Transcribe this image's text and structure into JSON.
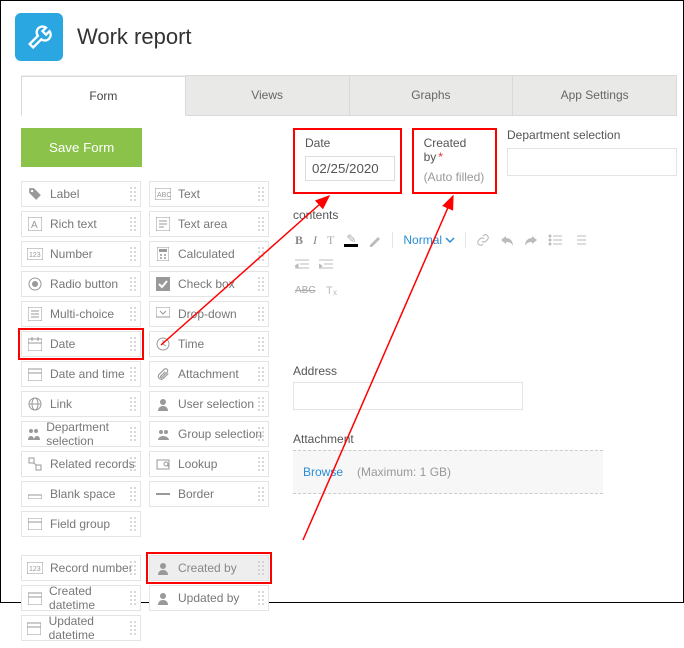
{
  "app": {
    "title": "Work report"
  },
  "tabs": [
    {
      "label": "Form",
      "active": true
    },
    {
      "label": "Views"
    },
    {
      "label": "Graphs"
    },
    {
      "label": "App Settings"
    }
  ],
  "buttons": {
    "save_form": "Save Form"
  },
  "palette": {
    "left": [
      {
        "name": "label",
        "label": "Label",
        "icon": "tag"
      },
      {
        "name": "rich-text",
        "label": "Rich text",
        "icon": "rich"
      },
      {
        "name": "number",
        "label": "Number",
        "icon": "num"
      },
      {
        "name": "radio-button",
        "label": "Radio button",
        "icon": "radio"
      },
      {
        "name": "multi-choice",
        "label": "Multi-choice",
        "icon": "multi"
      },
      {
        "name": "date",
        "label": "Date",
        "icon": "cal",
        "highlight": true
      },
      {
        "name": "date-and-time",
        "label": "Date and time",
        "icon": "cal"
      },
      {
        "name": "link",
        "label": "Link",
        "icon": "globe"
      },
      {
        "name": "department-selection",
        "label": "Department selection",
        "icon": "dept"
      },
      {
        "name": "related-records",
        "label": "Related records",
        "icon": "related"
      },
      {
        "name": "blank-space",
        "label": "Blank space",
        "icon": "blank"
      },
      {
        "name": "field-group",
        "label": "Field group",
        "icon": "group"
      }
    ],
    "right": [
      {
        "name": "text",
        "label": "Text",
        "icon": "abc"
      },
      {
        "name": "text-area",
        "label": "Text area",
        "icon": "textarea"
      },
      {
        "name": "calculated",
        "label": "Calculated",
        "icon": "calc"
      },
      {
        "name": "check-box",
        "label": "Check box",
        "icon": "check"
      },
      {
        "name": "drop-down",
        "label": "Drop-down",
        "icon": "drop"
      },
      {
        "name": "time",
        "label": "Time",
        "icon": "clock"
      },
      {
        "name": "attachment",
        "label": "Attachment",
        "icon": "clip"
      },
      {
        "name": "user-selection",
        "label": "User selection",
        "icon": "user"
      },
      {
        "name": "group-selection",
        "label": "Group selection",
        "icon": "group2"
      },
      {
        "name": "lookup",
        "label": "Lookup",
        "icon": "lookup"
      },
      {
        "name": "border",
        "label": "Border",
        "icon": "border"
      }
    ],
    "system_left": [
      {
        "name": "record-number",
        "label": "Record number",
        "icon": "num"
      },
      {
        "name": "created-datetime",
        "label": "Created datetime",
        "icon": "cal"
      },
      {
        "name": "updated-datetime",
        "label": "Updated datetime",
        "icon": "cal"
      }
    ],
    "system_right": [
      {
        "name": "created-by",
        "label": "Created by",
        "icon": "user",
        "highlight": true,
        "dim": true
      },
      {
        "name": "updated-by",
        "label": "Updated by",
        "icon": "user"
      }
    ]
  },
  "form": {
    "date": {
      "label": "Date",
      "value": "02/25/2020"
    },
    "created_by": {
      "label": "Created by",
      "value": "(Auto filled)",
      "required_mark": "*"
    },
    "department": {
      "label": "Department selection"
    },
    "contents": {
      "label": "contents",
      "normal": "Normal"
    },
    "address": {
      "label": "Address"
    },
    "attachment": {
      "label": "Attachment",
      "browse": "Browse",
      "hint": "(Maximum: 1 GB)"
    }
  }
}
